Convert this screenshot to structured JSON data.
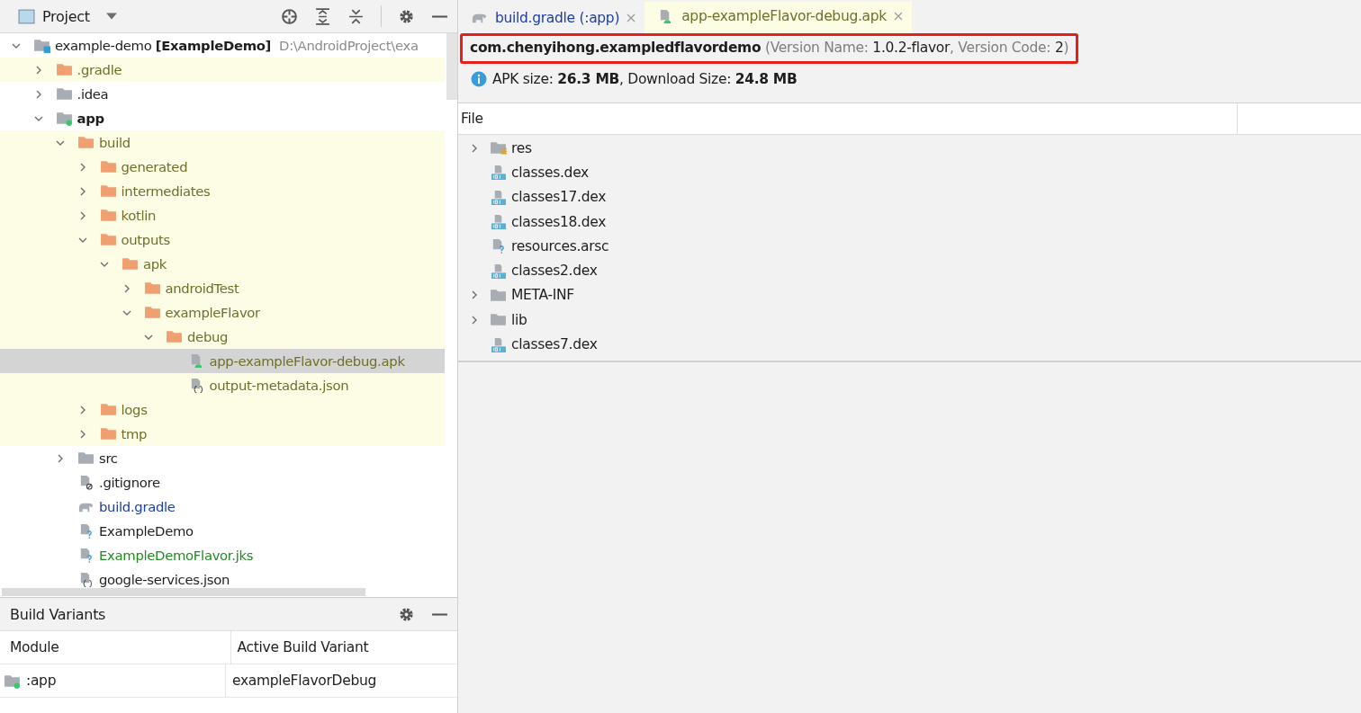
{
  "project_panel": {
    "title": "Project",
    "tree": [
      {
        "kind": "project",
        "label": "example-demo **[ExampleDemo]**",
        "path": "D:\\AndroidProject\\exa",
        "expanded": true,
        "excluded": false,
        "selected": false,
        "children": [
          {
            "kind": "folder",
            "label": ".gradle",
            "expanded": false,
            "excluded": true,
            "selected": false
          },
          {
            "kind": "folder-plain",
            "label": ".idea",
            "expanded": false,
            "excluded": false,
            "selected": false
          },
          {
            "kind": "module",
            "label": "app",
            "expanded": true,
            "excluded": false,
            "selected": false,
            "children": [
              {
                "kind": "folder",
                "label": "build",
                "expanded": true,
                "excluded": true,
                "selected": false,
                "children": [
                  {
                    "kind": "folder",
                    "label": "generated",
                    "expanded": false,
                    "excluded": true,
                    "selected": false
                  },
                  {
                    "kind": "folder",
                    "label": "intermediates",
                    "expanded": false,
                    "excluded": true,
                    "selected": false
                  },
                  {
                    "kind": "folder",
                    "label": "kotlin",
                    "expanded": false,
                    "excluded": true,
                    "selected": false
                  },
                  {
                    "kind": "folder",
                    "label": "outputs",
                    "expanded": true,
                    "excluded": true,
                    "selected": false,
                    "children": [
                      {
                        "kind": "folder",
                        "label": "apk",
                        "expanded": true,
                        "excluded": true,
                        "selected": false,
                        "children": [
                          {
                            "kind": "folder",
                            "label": "androidTest",
                            "expanded": false,
                            "excluded": true,
                            "selected": false
                          },
                          {
                            "kind": "folder",
                            "label": "exampleFlavor",
                            "expanded": true,
                            "excluded": true,
                            "selected": false,
                            "children": [
                              {
                                "kind": "folder",
                                "label": "debug",
                                "expanded": true,
                                "excluded": true,
                                "selected": false,
                                "children": [
                                  {
                                    "kind": "apk",
                                    "label": "app-exampleFlavor-debug.apk",
                                    "excluded": true,
                                    "selected": true
                                  },
                                  {
                                    "kind": "json",
                                    "label": "output-metadata.json",
                                    "excluded": true,
                                    "selected": false
                                  }
                                ]
                              }
                            ]
                          }
                        ]
                      }
                    ]
                  },
                  {
                    "kind": "folder",
                    "label": "logs",
                    "expanded": false,
                    "excluded": true,
                    "selected": false
                  },
                  {
                    "kind": "folder",
                    "label": "tmp",
                    "expanded": false,
                    "excluded": true,
                    "selected": false
                  }
                ]
              },
              {
                "kind": "folder-plain",
                "label": "src",
                "expanded": false,
                "excluded": false,
                "selected": false
              },
              {
                "kind": "ignore",
                "label": ".gitignore",
                "excluded": false,
                "selected": false
              },
              {
                "kind": "gradle",
                "label": "build.gradle",
                "color": "#1d3fa3",
                "excluded": false,
                "selected": false
              },
              {
                "kind": "unknown",
                "label": "ExampleDemo",
                "excluded": false,
                "selected": false
              },
              {
                "kind": "unknown",
                "label": "ExampleDemoFlavor.jks",
                "color": "#238a22",
                "excluded": false,
                "selected": false
              },
              {
                "kind": "json",
                "label": "google-services.json",
                "excluded": false,
                "selected": false
              }
            ]
          }
        ]
      }
    ]
  },
  "build_variants": {
    "title": "Build Variants",
    "columns": [
      "Module",
      "Active Build Variant"
    ],
    "rows": [
      {
        "module": ":app",
        "variant": "exampleFlavorDebug"
      }
    ]
  },
  "editor_tabs": [
    {
      "kind": "gradle",
      "label": "build.gradle (:app)",
      "selected": false
    },
    {
      "kind": "apk",
      "label": "app-exampleFlavor-debug.apk",
      "selected": true
    }
  ],
  "apk_header": {
    "package": "com.chenyihong.exampledflavordemo",
    "version_name_label": "(Version Name:",
    "version_name": "1.0.2-flavor",
    "version_code_label": ", Version Code:",
    "version_code": "2",
    "close": ")",
    "highlighted": true
  },
  "apk_size": "APK size: **26.3 MB**, Download Size: **24.8 MB**",
  "file_table": {
    "columns": [
      "File"
    ],
    "rows": [
      {
        "kind": "res",
        "label": "res",
        "expanded": false
      },
      {
        "kind": "dex",
        "label": "classes.dex"
      },
      {
        "kind": "dex",
        "label": "classes17.dex"
      },
      {
        "kind": "dex",
        "label": "classes18.dex"
      },
      {
        "kind": "unknown",
        "label": "resources.arsc"
      },
      {
        "kind": "dex",
        "label": "classes2.dex"
      },
      {
        "kind": "folder-plain",
        "label": "META-INF",
        "expanded": false
      },
      {
        "kind": "folder-plain",
        "label": "lib",
        "expanded": false
      },
      {
        "kind": "dex",
        "label": "classes7.dex"
      }
    ]
  }
}
